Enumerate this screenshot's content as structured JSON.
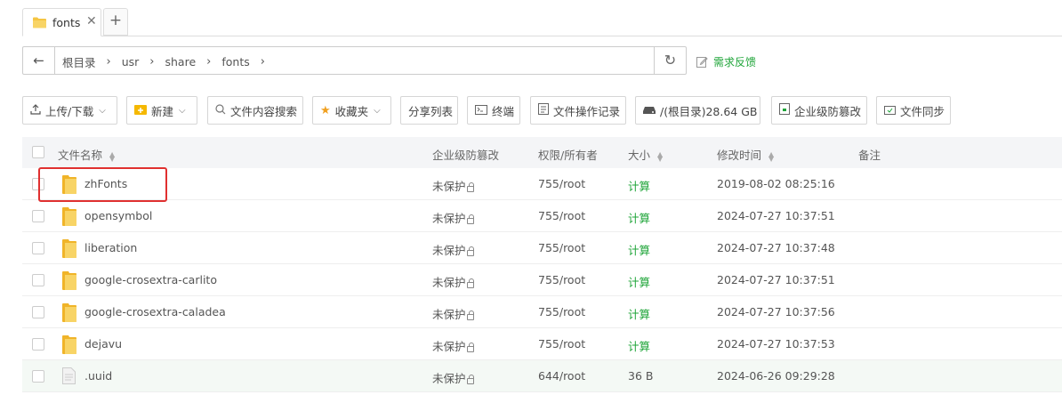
{
  "tabs": [
    {
      "label": "fonts",
      "close": "✕"
    }
  ],
  "tab_add": "+",
  "path": {
    "back": "←",
    "crumbs": [
      "根目录",
      "usr",
      "share",
      "fonts"
    ],
    "refresh": "↻"
  },
  "feedback": "需求反馈",
  "toolbar": {
    "upload": "上传/下载",
    "new": "新建",
    "search": "文件内容搜索",
    "favorites": "收藏夹",
    "share_list": "分享列表",
    "terminal": "终端",
    "op_log": "文件操作记录",
    "disk": "/(根目录)28.64 GB",
    "tamper": "企业级防篡改",
    "sync": "文件同步"
  },
  "columns": {
    "name": "文件名称",
    "tamper": "企业级防篡改",
    "perm": "权限/所有者",
    "size": "大小",
    "mtime": "修改时间",
    "note": "备注"
  },
  "rows": [
    {
      "name": "zhFonts",
      "type": "folder",
      "protect": "未保护",
      "perm": "755/root",
      "size": "计算",
      "mtime": "2019-08-02 08:25:16"
    },
    {
      "name": "opensymbol",
      "type": "folder",
      "protect": "未保护",
      "perm": "755/root",
      "size": "计算",
      "mtime": "2024-07-27 10:37:51"
    },
    {
      "name": "liberation",
      "type": "folder",
      "protect": "未保护",
      "perm": "755/root",
      "size": "计算",
      "mtime": "2024-07-27 10:37:48"
    },
    {
      "name": "google-crosextra-carlito",
      "type": "folder",
      "protect": "未保护",
      "perm": "755/root",
      "size": "计算",
      "mtime": "2024-07-27 10:37:51"
    },
    {
      "name": "google-crosextra-caladea",
      "type": "folder",
      "protect": "未保护",
      "perm": "755/root",
      "size": "计算",
      "mtime": "2024-07-27 10:37:56"
    },
    {
      "name": "dejavu",
      "type": "folder",
      "protect": "未保护",
      "perm": "755/root",
      "size": "计算",
      "mtime": "2024-07-27 10:37:53"
    },
    {
      "name": ".uuid",
      "type": "file",
      "protect": "未保护",
      "perm": "644/root",
      "size": "36 B",
      "mtime": "2024-06-26 09:29:28"
    }
  ],
  "colors": {
    "accent": "#20a53a",
    "folder": "#f5c542",
    "highlight": "#e03030"
  }
}
